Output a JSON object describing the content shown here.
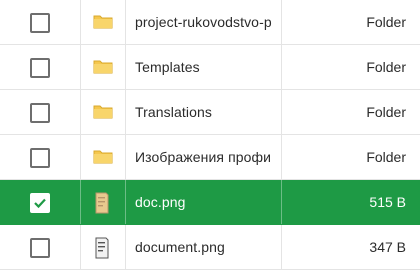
{
  "files": [
    {
      "name": "project-rukovodstvo-p",
      "size": "Folder",
      "icon": "folder-icon",
      "selected": false
    },
    {
      "name": "Templates",
      "size": "Folder",
      "icon": "folder-icon",
      "selected": false
    },
    {
      "name": "Translations",
      "size": "Folder",
      "icon": "folder-icon",
      "selected": false
    },
    {
      "name": "Изображения профи",
      "size": "Folder",
      "icon": "folder-icon",
      "selected": false
    },
    {
      "name": "doc.png",
      "size": "515 B",
      "icon": "image-file-icon",
      "selected": true
    },
    {
      "name": "document.png",
      "size": "347 B",
      "icon": "image-file-icon",
      "selected": false
    }
  ],
  "colors": {
    "selected_row": "#1e9a45",
    "folder": "#f5c74e",
    "border": "#e4e4e4"
  }
}
